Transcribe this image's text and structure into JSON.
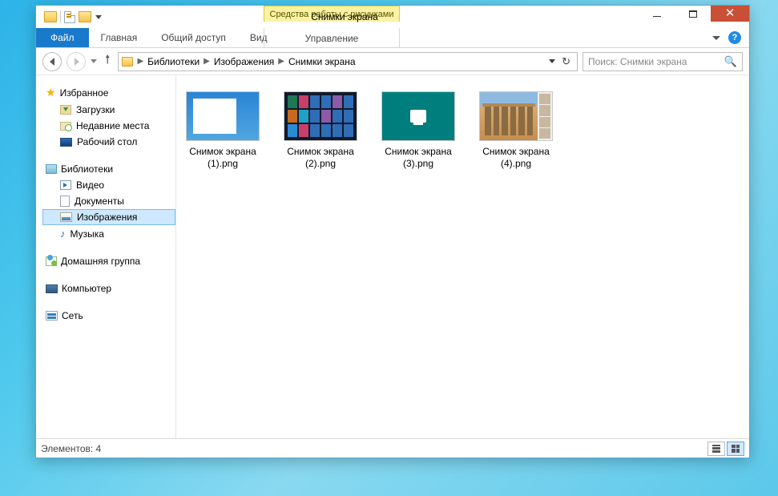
{
  "window_title": "Снимки экрана",
  "context_tab": "Средства работы с рисунками",
  "ribbon": {
    "file": "Файл",
    "home": "Главная",
    "share": "Общий доступ",
    "view": "Вид",
    "manage": "Управление"
  },
  "breadcrumbs": [
    "Библиотеки",
    "Изображения",
    "Снимки экрана"
  ],
  "search_placeholder": "Поиск: Снимки экрана",
  "nav_pane": {
    "favorites": {
      "label": "Избранное",
      "items": {
        "downloads": "Загрузки",
        "recent": "Недавние места",
        "desktop": "Рабочий стол"
      }
    },
    "libraries": {
      "label": "Библиотеки",
      "items": {
        "videos": "Видео",
        "documents": "Документы",
        "pictures": "Изображения",
        "music": "Музыка"
      }
    },
    "homegroup": "Домашняя группа",
    "computer": "Компьютер",
    "network": "Сеть"
  },
  "files": [
    {
      "name": "Снимок экрана (1).png"
    },
    {
      "name": "Снимок экрана (2).png"
    },
    {
      "name": "Снимок экрана (3).png"
    },
    {
      "name": "Снимок экрана (4).png"
    }
  ],
  "status": {
    "count_label": "Элементов: 4"
  }
}
